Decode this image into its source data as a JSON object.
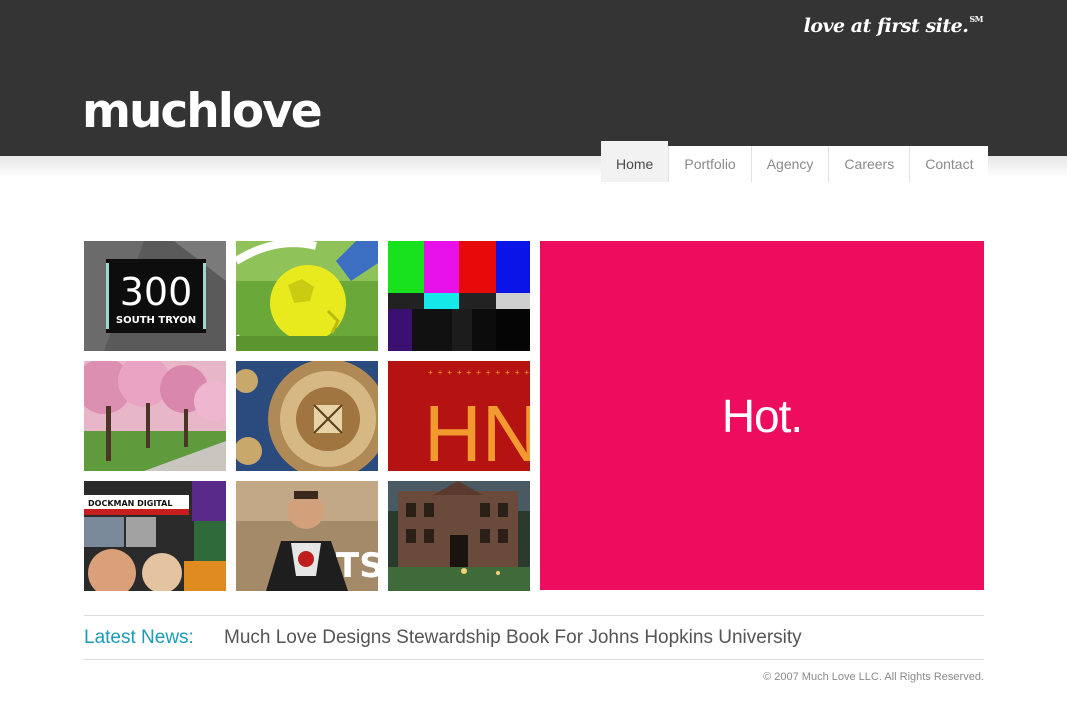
{
  "header": {
    "logo": "muchlove",
    "tagline": "love at first site.",
    "tagline_mark": "SM"
  },
  "nav": {
    "items": [
      {
        "label": "Home",
        "active": true
      },
      {
        "label": "Portfolio",
        "active": false
      },
      {
        "label": "Agency",
        "active": false
      },
      {
        "label": "Careers",
        "active": false
      },
      {
        "label": "Contact",
        "active": false
      }
    ]
  },
  "portfolio": {
    "tiles": [
      {
        "name": "300 South Tryon",
        "text_main": "300",
        "text_sub": "SOUTH TRYON"
      },
      {
        "name": "soccer ball"
      },
      {
        "name": "tv color bars"
      },
      {
        "name": "cherry blossom trees"
      },
      {
        "name": "university seal"
      },
      {
        "name": "HN red",
        "text_main": "HN"
      },
      {
        "name": "Dockman Digital",
        "text_main": "DOCKMAN DIGITAL"
      },
      {
        "name": "man portrait",
        "text_main": "TS"
      },
      {
        "name": "campus building"
      }
    ],
    "feature": {
      "text": "Hot.",
      "color": "#ee0c5f"
    }
  },
  "news": {
    "label": "Latest News:",
    "headline": "Much Love Designs Stewardship Book For Johns Hopkins University"
  },
  "footer": {
    "copyright": "© 2007 Much Love LLC. All Rights Reserved."
  },
  "colors": {
    "header_bg": "#343434",
    "accent": "#1a9bb8",
    "feature": "#ee0c5f"
  }
}
